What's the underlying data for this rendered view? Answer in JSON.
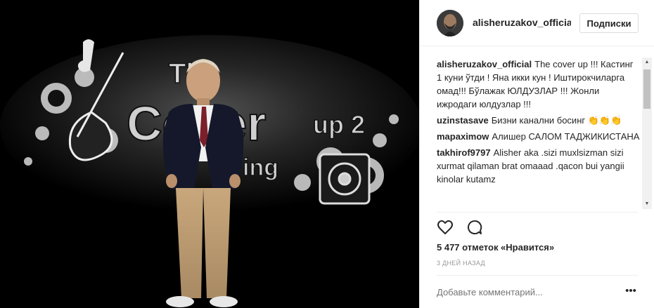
{
  "post": {
    "image_alt": "Man in suit standing in front of The Cover up 2 backdrop",
    "backdrop_title_line1": "The",
    "backdrop_title_line2": "Cover",
    "backdrop_title_suffix": "up 2",
    "backdrop_subtitle": "ing"
  },
  "header": {
    "username": "alisheruzakov_official",
    "follow_label": "Подписки"
  },
  "comments": [
    {
      "user": "alisheruzakov_official",
      "text": "The cover up !!! Кастинг 1 куни ўтди ! Яна икки кун ! Иштирокчиларга омад!!! Бўлажак ЮЛДУЗЛАР !!! Жонли ижродаги юлдузлар !!!"
    },
    {
      "user": "uzinstasave",
      "text": "Бизни канални босинг 👏👏👏"
    },
    {
      "user": "mapaximow",
      "text": "Алишер САЛОМ ТАДЖИКИСТАНА"
    },
    {
      "user": "takhirof9797",
      "text": "Alisher aka .sizi muxlsizman sizi xurmat qilaman brat omaaad .qacon bui yangii kinolar kutamz"
    }
  ],
  "actions": {
    "like_icon": "heart-icon",
    "comment_icon": "comment-bubble-icon"
  },
  "likes_text": "5 477 отметок «Нравится»",
  "time_text": "3 дней назад",
  "add_comment_placeholder": "Добавьте комментарий...",
  "more_label": "•••",
  "scroll": {
    "up": "▲",
    "down": "▼"
  }
}
